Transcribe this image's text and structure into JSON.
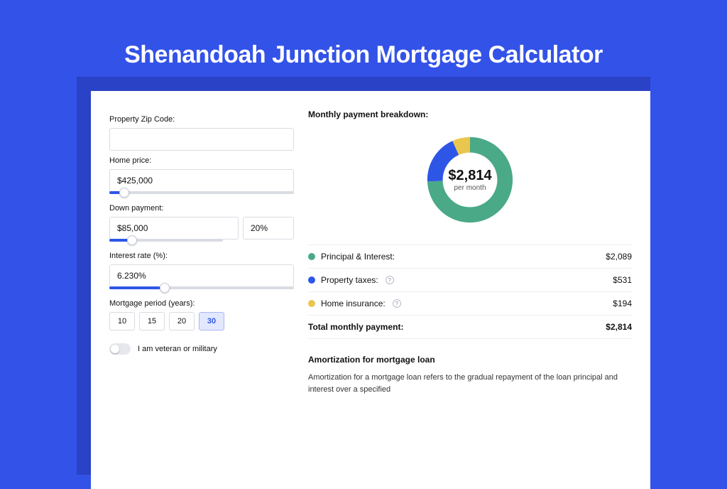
{
  "title": "Shenandoah Junction Mortgage Calculator",
  "form": {
    "zip_label": "Property Zip Code:",
    "zip_value": "",
    "home_price_label": "Home price:",
    "home_price_value": "$425,000",
    "home_price_slider_pct": 8,
    "down_payment_label": "Down payment:",
    "down_payment_value": "$85,000",
    "down_payment_pct_value": "20%",
    "down_payment_slider_pct": 20,
    "interest_label": "Interest rate (%):",
    "interest_value": "6.230%",
    "interest_slider_pct": 30,
    "period_label": "Mortgage period (years):",
    "periods": [
      "10",
      "15",
      "20",
      "30"
    ],
    "period_active_index": 3,
    "vet_label": "I am veteran or military",
    "vet_on": false
  },
  "breakdown": {
    "heading": "Monthly payment breakdown:",
    "center_amount": "$2,814",
    "center_sub": "per month",
    "rows": [
      {
        "color": "green",
        "label": "Principal & Interest:",
        "value": "$2,089",
        "info": false
      },
      {
        "color": "blue",
        "label": "Property taxes:",
        "value": "$531",
        "info": true
      },
      {
        "color": "yellow",
        "label": "Home insurance:",
        "value": "$194",
        "info": true
      }
    ],
    "total_label": "Total monthly payment:",
    "total_value": "$2,814"
  },
  "amortization": {
    "heading": "Amortization for mortgage loan",
    "text": "Amortization for a mortgage loan refers to the gradual repayment of the loan principal and interest over a specified"
  },
  "chart_data": {
    "type": "pie",
    "title": "Monthly payment breakdown",
    "series": [
      {
        "name": "Principal & Interest",
        "value": 2089,
        "color": "#4aa986"
      },
      {
        "name": "Property taxes",
        "value": 531,
        "color": "#2e56e6"
      },
      {
        "name": "Home insurance",
        "value": 194,
        "color": "#e9c64e"
      }
    ],
    "total": 2814
  }
}
